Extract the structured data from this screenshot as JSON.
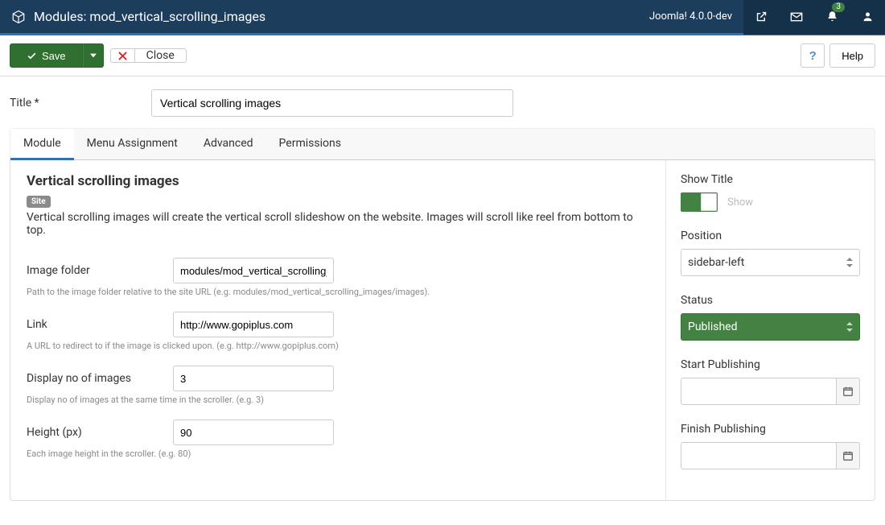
{
  "header": {
    "title": "Modules: mod_vertical_scrolling_images",
    "version": "Joomla! 4.0.0-dev",
    "badge_count": "3"
  },
  "toolbar": {
    "save_label": "Save",
    "close_label": "Close",
    "help_label": "Help"
  },
  "title_field": {
    "label": "Title *",
    "value": "Vertical scrolling images"
  },
  "tabs": [
    "Module",
    "Menu Assignment",
    "Advanced",
    "Permissions"
  ],
  "module": {
    "heading": "Vertical scrolling images",
    "site_badge": "Site",
    "description": "Vertical scrolling images will create the vertical scroll slideshow on the website. Images will scroll like reel from bottom to top.",
    "fields": [
      {
        "label": "Image folder",
        "value": "modules/mod_vertical_scrolling_images/images",
        "help": "Path to the image folder relative to the site URL (e.g. modules/mod_vertical_scrolling_images/images)."
      },
      {
        "label": "Link",
        "value": "http://www.gopiplus.com",
        "help": "A URL to redirect to if the image is clicked upon. (e.g. http://www.gopiplus.com)"
      },
      {
        "label": "Display no of images",
        "value": "3",
        "help": "Display no of images at the same time in the scroller. (e.g. 3)"
      },
      {
        "label": "Height (px)",
        "value": "90",
        "help": "Each image height in the scroller. (e.g. 80)"
      }
    ]
  },
  "sidebar": {
    "show_title_label": "Show Title",
    "show_title_value": "Show",
    "position_label": "Position",
    "position_value": "sidebar-left",
    "status_label": "Status",
    "status_value": "Published",
    "start_pub_label": "Start Publishing",
    "start_pub_value": "",
    "finish_pub_label": "Finish Publishing",
    "finish_pub_value": ""
  }
}
